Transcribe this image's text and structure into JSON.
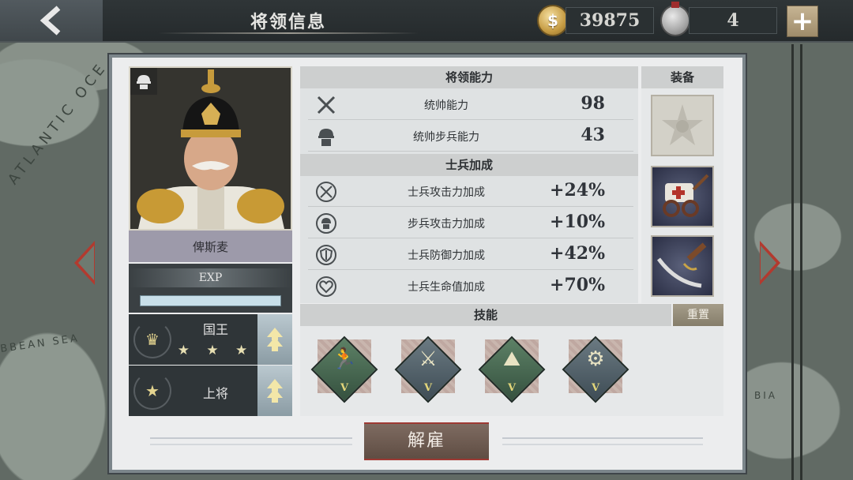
{
  "header": {
    "back_icon": "chevron-left-icon",
    "title": "将领信息",
    "coins": "39875",
    "coin_icon": "dollar-coin-icon",
    "medals": "4",
    "medal_icon": "medal-icon",
    "add_icon": "plus-icon"
  },
  "map": {
    "atlantic": "ATLANTIC OCE",
    "caribbean": "BBEAN SEA",
    "bia": "BIA"
  },
  "general": {
    "name": "俾斯麦",
    "exp_label": "EXP",
    "exp_progress": 1.0,
    "rank1": {
      "name": "国王",
      "stars": "★ ★ ★",
      "icon": "crown-icon"
    },
    "rank2": {
      "name": "上将",
      "icon": "general-star-icon"
    }
  },
  "abilities": {
    "header": "将领能力",
    "rows": [
      {
        "label": "统帅能力",
        "value": "98",
        "icon": "crossed-swords-icon"
      },
      {
        "label": "统帅步兵能力",
        "value": "43",
        "icon": "infantry-helmet-icon"
      }
    ]
  },
  "bonus": {
    "header": "士兵加成",
    "rows": [
      {
        "label": "士兵攻击力加成",
        "value": "+24%",
        "icon": "attack-up-icon"
      },
      {
        "label": "步兵攻击力加成",
        "value": "+10%",
        "icon": "infantry-up-icon"
      },
      {
        "label": "士兵防御力加成",
        "value": "+42%",
        "icon": "defense-up-icon"
      },
      {
        "label": "士兵生命值加成",
        "value": "+70%",
        "icon": "health-up-icon"
      }
    ]
  },
  "equipment": {
    "header": "装备",
    "slots": [
      "order-medal-icon",
      "ambulance-cart-icon",
      "sabre-icon"
    ]
  },
  "skills": {
    "header": "技能",
    "reset_label": "重置",
    "items": [
      {
        "level": "V",
        "color": "green",
        "icon": "sprinting-soldier-icon"
      },
      {
        "level": "V",
        "color": "blue",
        "icon": "cavalry-sabre-icon"
      },
      {
        "level": "V",
        "color": "green",
        "icon": "prone-soldier-icon"
      },
      {
        "level": "V",
        "color": "blue",
        "icon": "artillery-icon"
      }
    ]
  },
  "dismiss_label": "解雇",
  "colors": {
    "accent_red": "#b23a2f",
    "panel": "#ecedee",
    "gold": "#c59b43"
  }
}
